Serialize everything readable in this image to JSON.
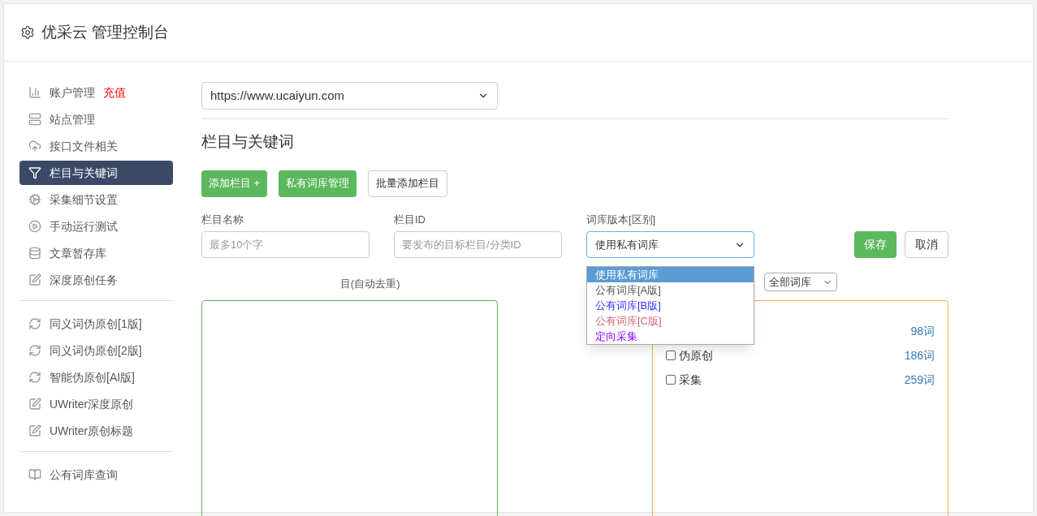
{
  "header": {
    "title": "优采云 管理控制台"
  },
  "sidebar": {
    "groups": [
      {
        "items": [
          {
            "label": "账户管理",
            "badge": "充值",
            "selected": false
          },
          {
            "label": "站点管理",
            "selected": false
          },
          {
            "label": "接口文件相关",
            "selected": false
          },
          {
            "label": "栏目与关键词",
            "selected": true
          },
          {
            "label": "采集细节设置",
            "selected": false
          },
          {
            "label": "手动运行测试",
            "selected": false
          },
          {
            "label": "文章暂存库",
            "selected": false
          },
          {
            "label": "深度原创任务",
            "selected": false
          }
        ]
      },
      {
        "items": [
          {
            "label": "同义词伪原创[1版]",
            "selected": false
          },
          {
            "label": "同义词伪原创[2版]",
            "selected": false
          },
          {
            "label": "智能伪原创[AI版]",
            "selected": false
          },
          {
            "label": "UWriter深度原创",
            "selected": false
          },
          {
            "label": "UWriter原创标题",
            "selected": false
          }
        ]
      },
      {
        "items": [
          {
            "label": "公有词库查询",
            "selected": false
          }
        ]
      }
    ]
  },
  "site_select": {
    "value": "https://www.ucaiyun.com"
  },
  "section_title": "栏目与关键词",
  "buttons": [
    {
      "label": "添加栏目 +",
      "kind": "primary"
    },
    {
      "label": "私有词库管理",
      "kind": "primary"
    },
    {
      "label": "批量添加栏目",
      "kind": "default"
    }
  ],
  "form": {
    "name": {
      "label": "栏目名称",
      "placeholder": "最多10个字"
    },
    "id": {
      "label": "栏目ID",
      "placeholder": "要发布的目标栏目/分类ID"
    },
    "version": {
      "label": "词库版本[区别]",
      "value": "使用私有词库",
      "expanded": true,
      "options": [
        {
          "label": "使用私有词库",
          "selected": true,
          "color": "#ffffff"
        },
        {
          "label": "公有词库[A版]",
          "selected": false,
          "color": "#555555"
        },
        {
          "label": "公有词库[B版]",
          "selected": false,
          "color": "#3333ff"
        },
        {
          "label": "公有词库[C版]",
          "selected": false,
          "color": "#cc6677"
        },
        {
          "label": "定向采集",
          "selected": false,
          "color": "#8800ff"
        }
      ]
    },
    "save": "保存",
    "cancel": "取消"
  },
  "selected_label": "目(自动去重)",
  "library_filter": {
    "value": "全部词库"
  },
  "libraries": [
    {
      "count": "98词"
    },
    {
      "label": "伪原创",
      "count": "186词",
      "checked": false
    },
    {
      "label": "采集",
      "count": "259词",
      "checked": false
    }
  ]
}
